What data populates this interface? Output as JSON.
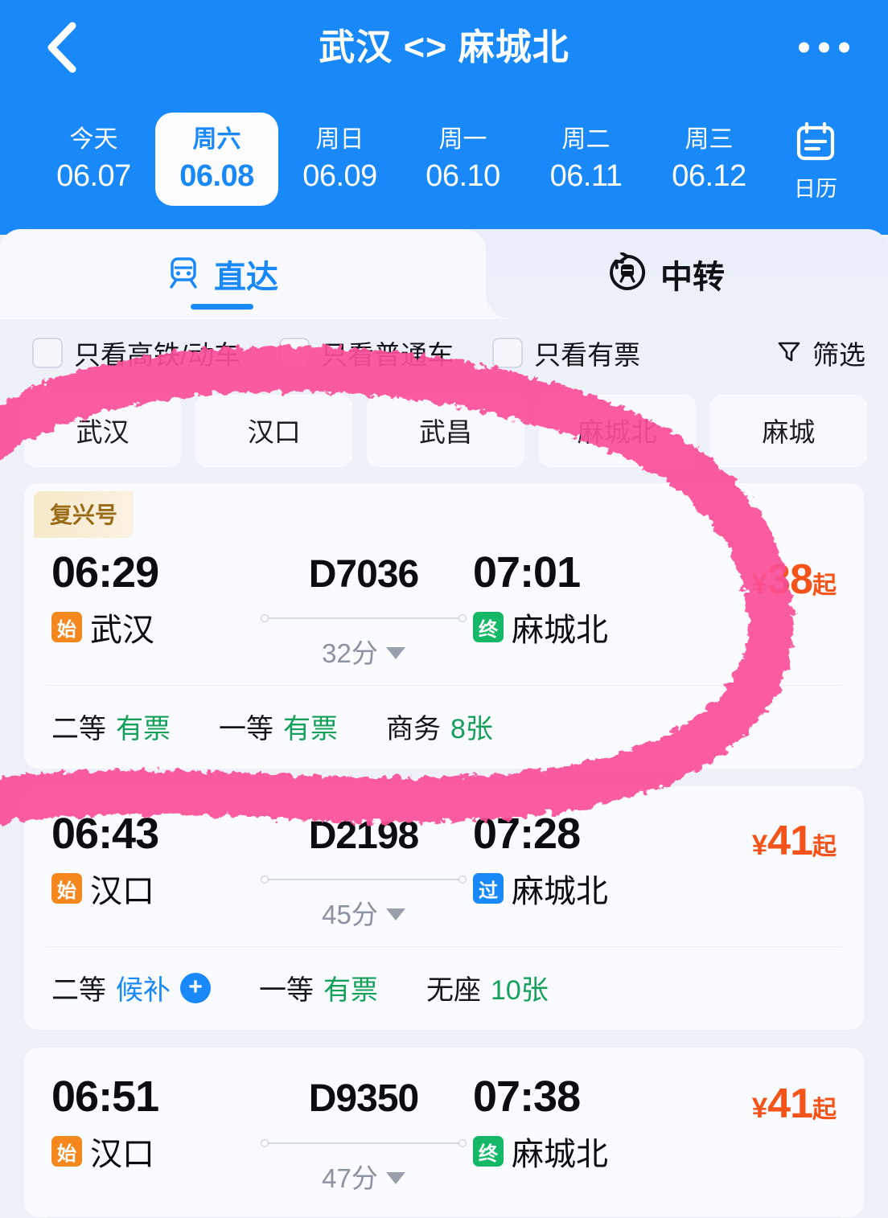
{
  "header": {
    "title": "武汉 <> 麻城北",
    "back_icon": "chevron-left-icon",
    "more_icon": "more-horizontal-icon",
    "accent_color": "#1989fa",
    "dates": [
      {
        "dow": "今天",
        "date": "06.07",
        "active": false
      },
      {
        "dow": "周六",
        "date": "06.08",
        "active": true
      },
      {
        "dow": "周日",
        "date": "06.09",
        "active": false
      },
      {
        "dow": "周一",
        "date": "06.10",
        "active": false
      },
      {
        "dow": "周二",
        "date": "06.11",
        "active": false
      },
      {
        "dow": "周三",
        "date": "06.12",
        "active": false
      }
    ],
    "calendar_label": "日历",
    "calendar_icon": "calendar-icon"
  },
  "tabs": [
    {
      "label": "直达",
      "icon": "train-front-icon",
      "active": true
    },
    {
      "label": "中转",
      "icon": "train-transfer-icon",
      "active": false
    }
  ],
  "filters": {
    "checkboxes": [
      {
        "label": "只看高铁/动车",
        "checked": false
      },
      {
        "label": "只看普通车",
        "checked": false
      },
      {
        "label": "只看有票",
        "checked": false
      }
    ],
    "filter_label": "筛选",
    "filter_icon": "funnel-icon"
  },
  "station_chips": [
    {
      "label": "武汉"
    },
    {
      "label": "汉口"
    },
    {
      "label": "武昌"
    },
    {
      "label": "麻城北"
    },
    {
      "label": "麻城"
    }
  ],
  "trains": [
    {
      "tag": "复兴号",
      "depart_time": "06:29",
      "depart_badge": "始",
      "depart_badge_type": "start",
      "depart_station": "武汉",
      "train_no": "D7036",
      "duration": "32分",
      "arrive_time": "07:01",
      "arrive_badge": "终",
      "arrive_badge_type": "end",
      "arrive_station": "麻城北",
      "price_currency": "¥",
      "price_amount": "38",
      "price_suffix": "起",
      "seats": [
        {
          "name": "二等",
          "value": "有票",
          "state": "ok"
        },
        {
          "name": "一等",
          "value": "有票",
          "state": "ok"
        },
        {
          "name": "商务",
          "value": "8张",
          "state": "ok"
        }
      ]
    },
    {
      "tag": "",
      "depart_time": "06:43",
      "depart_badge": "始",
      "depart_badge_type": "start",
      "depart_station": "汉口",
      "train_no": "D2198",
      "duration": "45分",
      "arrive_time": "07:28",
      "arrive_badge": "过",
      "arrive_badge_type": "pass",
      "arrive_station": "麻城北",
      "price_currency": "¥",
      "price_amount": "41",
      "price_suffix": "起",
      "seats": [
        {
          "name": "二等",
          "value": "候补",
          "state": "wait",
          "plus": "+"
        },
        {
          "name": "一等",
          "value": "有票",
          "state": "ok"
        },
        {
          "name": "无座",
          "value": "10张",
          "state": "ok"
        }
      ]
    },
    {
      "tag": "",
      "depart_time": "06:51",
      "depart_badge": "始",
      "depart_badge_type": "start",
      "depart_station": "汉口",
      "train_no": "D9350",
      "duration": "47分",
      "arrive_time": "07:38",
      "arrive_badge": "终",
      "arrive_badge_type": "end",
      "arrive_station": "麻城北",
      "price_currency": "¥",
      "price_amount": "41",
      "price_suffix": "起",
      "seats": []
    }
  ],
  "annotation": {
    "color": "#fb5a9e",
    "shape": "hand-drawn-pink-loop"
  }
}
